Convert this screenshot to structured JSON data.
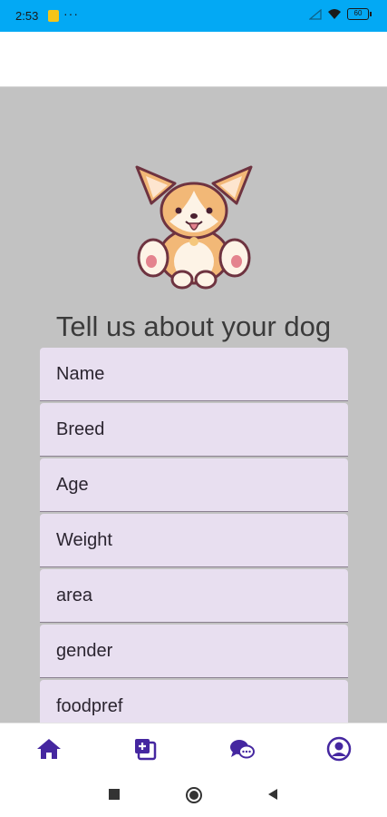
{
  "status_bar": {
    "time": "2:53",
    "dots": "···",
    "battery": "60"
  },
  "main": {
    "title": "Tell us about your dog",
    "fields": [
      {
        "placeholder": "Name"
      },
      {
        "placeholder": "Breed"
      },
      {
        "placeholder": "Age"
      },
      {
        "placeholder": "Weight"
      },
      {
        "placeholder": "area"
      },
      {
        "placeholder": "gender"
      },
      {
        "placeholder": "foodpref"
      }
    ]
  },
  "bottom_nav": {
    "items": [
      "home-icon",
      "add-photo-icon",
      "chat-icon",
      "profile-icon"
    ],
    "color": "#4527a0"
  },
  "colors": {
    "status_bar": "#03a9f4",
    "content_bg": "#c2c2c2",
    "field_bg": "#e8dff0"
  }
}
